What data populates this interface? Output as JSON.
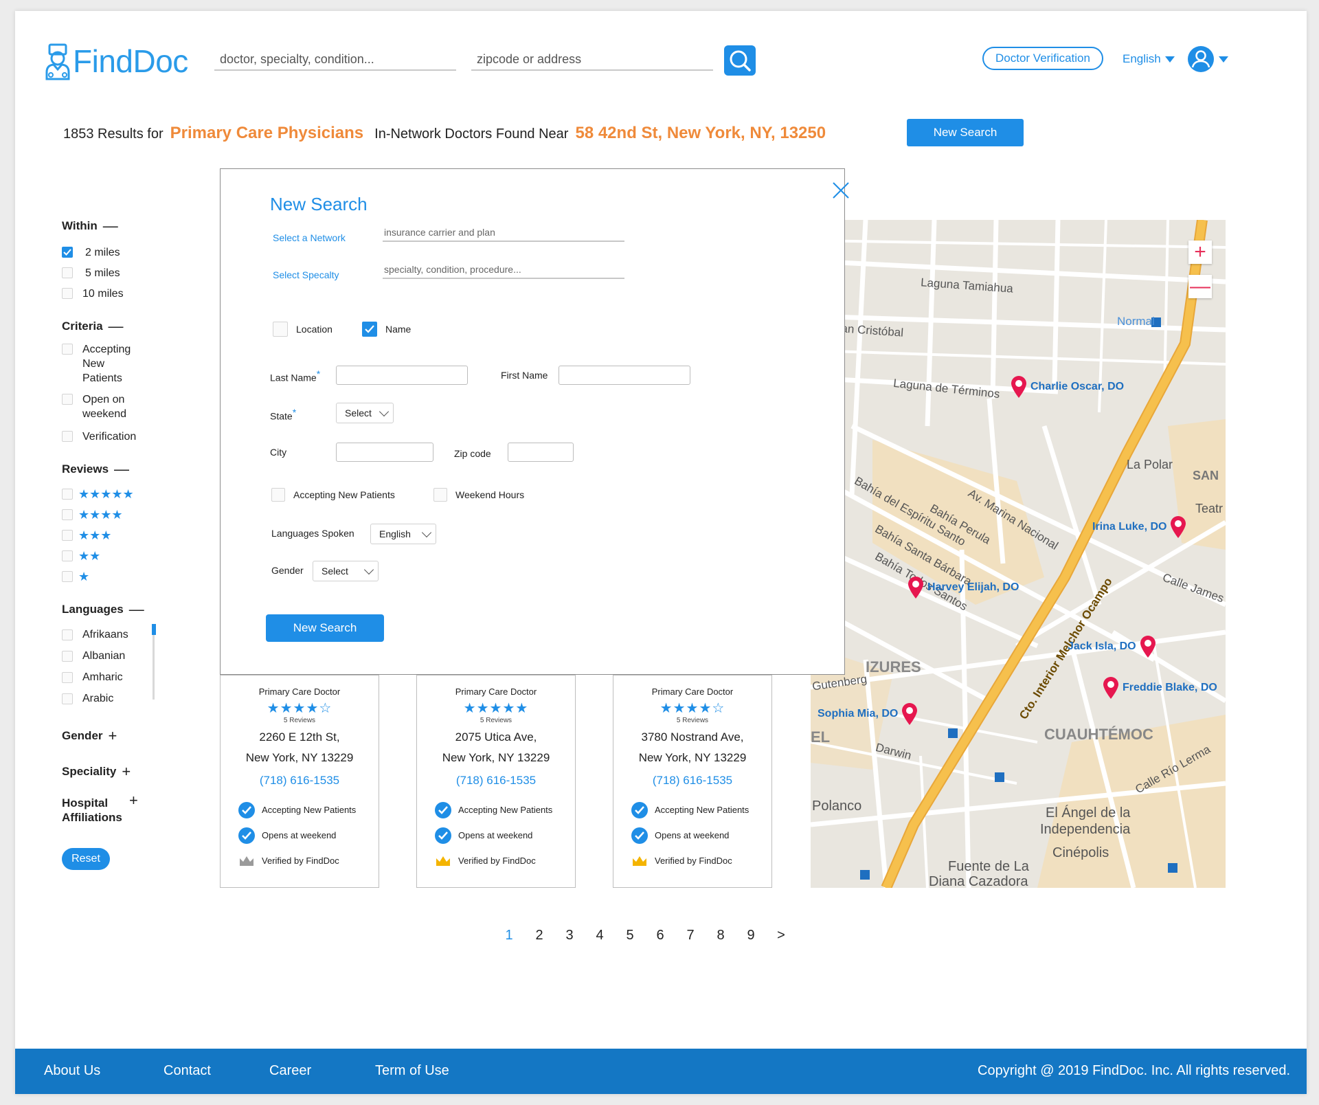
{
  "header": {
    "logo_text": "FindDoc",
    "search_placeholder": "doctor, specialty, condition...",
    "location_placeholder": "zipcode or address",
    "verify_label": "Doctor Verification",
    "language": "English"
  },
  "results": {
    "count_prefix": "1853 Results for",
    "specialty": "Primary Care Physicians",
    "middle_text": "In-Network Doctors Found Near",
    "address": "58 42nd St, New York, NY, 13250",
    "new_search_label": "New Search"
  },
  "sidebar": {
    "within_title": "Within",
    "within_options": [
      "2 miles",
      "5 miles",
      "10 miles"
    ],
    "criteria_title": "Criteria",
    "criteria_options": [
      "Accepting New Patients",
      "Open on weekend",
      "Verification"
    ],
    "reviews_title": "Reviews",
    "reviews_stars": [
      "★★★★★",
      "★★★★",
      "★★★",
      "★★",
      "★"
    ],
    "languages_title": "Languages",
    "languages": [
      "Afrikaans",
      "Albanian",
      "Amharic",
      "Arabic"
    ],
    "gender_title": "Gender",
    "speciality_title": "Speciality",
    "hospital_title_1": "Hospital",
    "hospital_title_2": "Affiliations",
    "reset_label": "Reset",
    "minus": "—",
    "plus": "+"
  },
  "modal": {
    "title": "New Search",
    "network_label": "Select a Network",
    "network_placeholder": "insurance carrier and plan",
    "specialty_label": "Select Specalty",
    "specialty_placeholder": "specialty, condition, procedure...",
    "location_label": "Location",
    "name_label": "Name",
    "last_name_label": "Last Name",
    "first_name_label": "First Name",
    "state_label": "State",
    "state_value": "Select",
    "city_label": "City",
    "zip_label": "Zip code",
    "accepting_label": "Accepting New Patients",
    "weekend_label": "Weekend Hours",
    "languages_label": "Languages Spoken",
    "languages_value": "English",
    "gender_label": "Gender",
    "gender_value": "Select",
    "submit_label": "New Search",
    "required_mark": "*"
  },
  "cards": [
    {
      "type": "Primary Care Doctor",
      "stars": "★★★★☆",
      "reviews": "5 Reviews",
      "addr1": "2260 E 12th St,",
      "addr2": "New York, NY 13229",
      "phone": "(718) 616-1535",
      "f1": "Accepting New Patients",
      "f2": "Opens at weekend",
      "f3": "Verified by FindDoc",
      "verified": false
    },
    {
      "type": "Primary Care Doctor",
      "stars": "★★★★★",
      "reviews": "5 Reviews",
      "addr1": "2075 Utica Ave,",
      "addr2": "New York, NY 13229",
      "phone": "(718) 616-1535",
      "f1": "Accepting New Patients",
      "f2": "Opens at weekend",
      "f3": "Verified by FindDoc",
      "verified": true
    },
    {
      "type": "Primary Care Doctor",
      "stars": "★★★★☆",
      "reviews": "5 Reviews",
      "addr1": "3780 Nostrand Ave,",
      "addr2": "New York, NY 13229",
      "phone": "(718) 616-1535",
      "f1": "Accepting New Patients",
      "f2": "Opens at weekend",
      "f3": "Verified by FindDoc",
      "verified": true
    }
  ],
  "map": {
    "streets": {
      "laguna_tamiahua": "Laguna Tamiahua",
      "san_cristobal": "una San Cristóbal",
      "laguna_terminos": "Laguna de Términos",
      "normal": "Normal",
      "la_polar": "La Polar",
      "bahia_espiritu": "Bahía del Espíritu Santo",
      "bahia_perula": "Bahía Perula",
      "bahia_santa_barbara": "Bahía Santa Bárbara",
      "bahia_todos_santos": "Bahía Todos Santos",
      "marina_nacional": "Av. Marina Nacional",
      "calle_james": "Calle James",
      "cto_interior": "Cto. Interior Melchor Ocampo",
      "izures": "IZURES",
      "cuauhtemoc": "CUAUHTÉMOC",
      "polanco": "Polanco",
      "angel": "El Ángel de la",
      "independencia": "Independencia",
      "cinepolis": "Cinépolis",
      "fuente": "Fuente de La",
      "diana": "Diana Cazadora",
      "gutenberg": "Gutenberg",
      "darwin": "Darwin",
      "calle_rio_lerma": "Calle Río Lerma",
      "teatr": "Teatr",
      "san": "SAN",
      "el": "EL"
    },
    "doctors": [
      "Charlie Oscar, DO",
      "Irina Luke, DO",
      "Harvey Elijah, DO",
      "Jack Isla, DO",
      "Freddie Blake, DO",
      "Sophia Mia, DO"
    ],
    "colors": {
      "road": "#ffffff",
      "highway": "#f6c04d",
      "pin": "#e6174f",
      "label": "#1f6fc0",
      "park": "#f3deb8"
    }
  },
  "pagination": {
    "pages": [
      "1",
      "2",
      "3",
      "4",
      "5",
      "6",
      "7",
      "8",
      "9"
    ],
    "next": ">",
    "current": "1"
  },
  "footer": {
    "about": "About Us",
    "contact": "Contact",
    "career": "Career",
    "terms": "Term of Use",
    "copyright": "Copyright @ 2019 FindDoc. Inc. All rights reserved."
  },
  "colors": {
    "brand": "#1f8ee6",
    "accent": "#ef8a3a",
    "footer": "#1477c4"
  }
}
